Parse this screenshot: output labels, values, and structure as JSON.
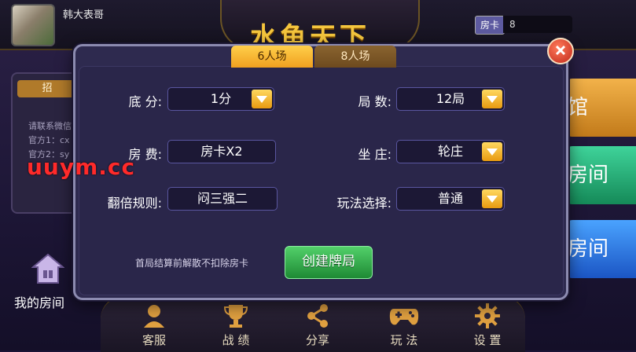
{
  "header": {
    "username": "韩大表哥",
    "game_title": "水鱼天下",
    "card_badge": "房卡",
    "card_count": "8"
  },
  "notice": {
    "tab_label": "招",
    "lines": [
      "请联系微信",
      "官方1：cx",
      "官方2：sy"
    ]
  },
  "watermark": "uuym.cc",
  "side_buttons": [
    {
      "label": "馆"
    },
    {
      "label": "房间"
    },
    {
      "label": "房间"
    }
  ],
  "my_room": {
    "label": "我的房间"
  },
  "bottom_nav": [
    {
      "label": "客服",
      "icon": "customer-service-icon"
    },
    {
      "label": "战 绩",
      "icon": "trophy-icon"
    },
    {
      "label": "分享",
      "icon": "share-icon"
    },
    {
      "label": "玩 法",
      "icon": "gamepad-icon"
    },
    {
      "label": "设 置",
      "icon": "gear-icon"
    }
  ],
  "dialog": {
    "tabs": [
      {
        "label": "6人场",
        "active": true
      },
      {
        "label": "8人场",
        "active": false
      }
    ],
    "fields": {
      "base_score": {
        "label": "底  分:",
        "value": "1分"
      },
      "rounds": {
        "label": "局 数:",
        "value": "12局"
      },
      "room_fee": {
        "label": "房 费:",
        "value": "房卡X2"
      },
      "banker": {
        "label": "坐 庄:",
        "value": "轮庄"
      },
      "double_rule": {
        "label": "翻倍规则:",
        "value": "闷三强二"
      },
      "play_mode": {
        "label": "玩法选择:",
        "value": "普通"
      }
    },
    "hint": "首局结算前解散不扣除房卡",
    "create_button": "创建牌局"
  },
  "colors": {
    "accent_gold": "#f0a020",
    "create_green": "#2ea84a",
    "dialog_bg": "#2e2a4f",
    "watermark_red": "#ff2a2a"
  }
}
